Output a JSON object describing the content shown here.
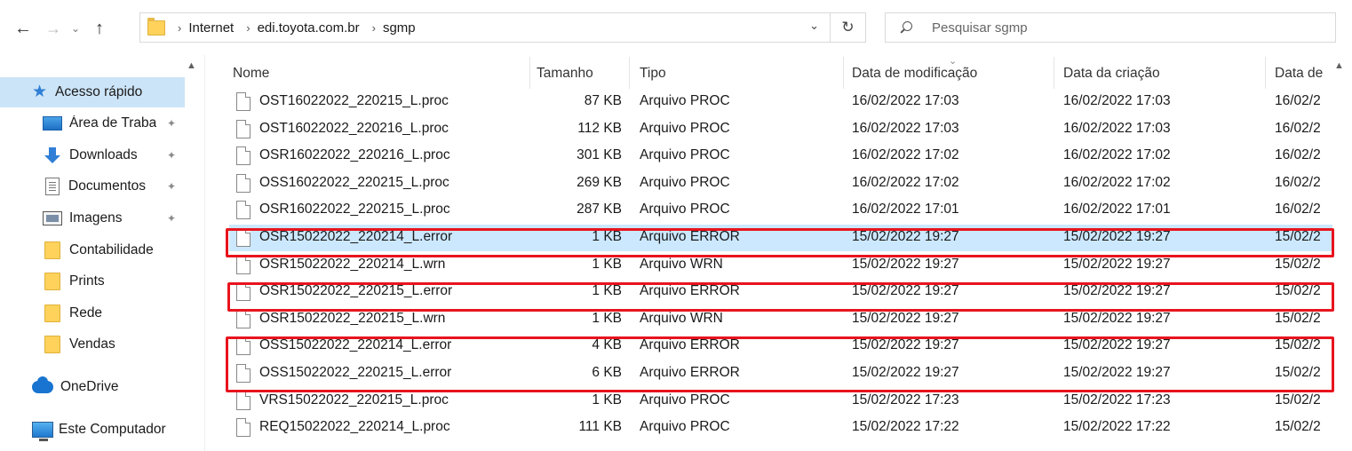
{
  "nav": {
    "back_icon": "arrow-left-icon",
    "forward_icon": "arrow-right-icon",
    "recent_icon": "chevron-down-icon",
    "up_icon": "arrow-up-icon"
  },
  "address": {
    "breadcrumbs": [
      "Internet",
      "edi.toyota.com.br",
      "sgmp"
    ]
  },
  "search": {
    "placeholder": "Pesquisar sgmp"
  },
  "sidebar": {
    "items": [
      {
        "label": "Acesso rápido",
        "icon": "star-icon",
        "pinned": false,
        "active": true
      },
      {
        "label": "Área de Traba",
        "icon": "desktop-icon",
        "pinned": true
      },
      {
        "label": "Downloads",
        "icon": "download-icon",
        "pinned": true
      },
      {
        "label": "Documentos",
        "icon": "document-icon",
        "pinned": true
      },
      {
        "label": "Imagens",
        "icon": "pictures-icon",
        "pinned": true
      },
      {
        "label": "Contabilidade",
        "icon": "folder-icon",
        "pinned": false
      },
      {
        "label": "Prints",
        "icon": "folder-icon",
        "pinned": false
      },
      {
        "label": "Rede",
        "icon": "folder-icon",
        "pinned": false
      },
      {
        "label": "Vendas",
        "icon": "folder-icon",
        "pinned": false
      },
      {
        "label": "OneDrive",
        "icon": "cloud-icon",
        "pinned": false
      },
      {
        "label": "Este Computador",
        "icon": "computer-icon",
        "pinned": false
      }
    ]
  },
  "columns": {
    "name": "Nome",
    "size": "Tamanho",
    "type": "Tipo",
    "modified": "Data de modificação",
    "created": "Data da criação",
    "other": "Data de"
  },
  "files": [
    {
      "name": "OST16022022_220215_L.proc",
      "size": "87 KB",
      "type": "Arquivo PROC",
      "modified": "16/02/2022 17:03",
      "created": "16/02/2022 17:03",
      "other": "16/02/2"
    },
    {
      "name": "OST16022022_220216_L.proc",
      "size": "112 KB",
      "type": "Arquivo PROC",
      "modified": "16/02/2022 17:03",
      "created": "16/02/2022 17:03",
      "other": "16/02/2"
    },
    {
      "name": "OSR16022022_220216_L.proc",
      "size": "301 KB",
      "type": "Arquivo PROC",
      "modified": "16/02/2022 17:02",
      "created": "16/02/2022 17:02",
      "other": "16/02/2"
    },
    {
      "name": "OSS16022022_220215_L.proc",
      "size": "269 KB",
      "type": "Arquivo PROC",
      "modified": "16/02/2022 17:02",
      "created": "16/02/2022 17:02",
      "other": "16/02/2"
    },
    {
      "name": "OSR16022022_220215_L.proc",
      "size": "287 KB",
      "type": "Arquivo PROC",
      "modified": "16/02/2022 17:01",
      "created": "16/02/2022 17:01",
      "other": "16/02/2"
    },
    {
      "name": "OSR15022022_220214_L.error",
      "size": "1 KB",
      "type": "Arquivo ERROR",
      "modified": "15/02/2022 19:27",
      "created": "15/02/2022 19:27",
      "other": "15/02/2",
      "selected": true
    },
    {
      "name": "OSR15022022_220214_L.wrn",
      "size": "1 KB",
      "type": "Arquivo WRN",
      "modified": "15/02/2022 19:27",
      "created": "15/02/2022 19:27",
      "other": "15/02/2"
    },
    {
      "name": "OSR15022022_220215_L.error",
      "size": "1 KB",
      "type": "Arquivo ERROR",
      "modified": "15/02/2022 19:27",
      "created": "15/02/2022 19:27",
      "other": "15/02/2"
    },
    {
      "name": "OSR15022022_220215_L.wrn",
      "size": "1 KB",
      "type": "Arquivo WRN",
      "modified": "15/02/2022 19:27",
      "created": "15/02/2022 19:27",
      "other": "15/02/2"
    },
    {
      "name": "OSS15022022_220214_L.error",
      "size": "4 KB",
      "type": "Arquivo ERROR",
      "modified": "15/02/2022 19:27",
      "created": "15/02/2022 19:27",
      "other": "15/02/2"
    },
    {
      "name": "OSS15022022_220215_L.error",
      "size": "6 KB",
      "type": "Arquivo ERROR",
      "modified": "15/02/2022 19:27",
      "created": "15/02/2022 19:27",
      "other": "15/02/2"
    },
    {
      "name": "VRS15022022_220215_L.proc",
      "size": "1 KB",
      "type": "Arquivo PROC",
      "modified": "15/02/2022 17:23",
      "created": "15/02/2022 17:23",
      "other": "15/02/2"
    },
    {
      "name": "REQ15022022_220214_L.proc",
      "size": "111 KB",
      "type": "Arquivo PROC",
      "modified": "15/02/2022 17:22",
      "created": "15/02/2022 17:22",
      "other": "15/02/2"
    }
  ],
  "highlight_color": "#e8141e",
  "selection_color": "#cce8ff"
}
